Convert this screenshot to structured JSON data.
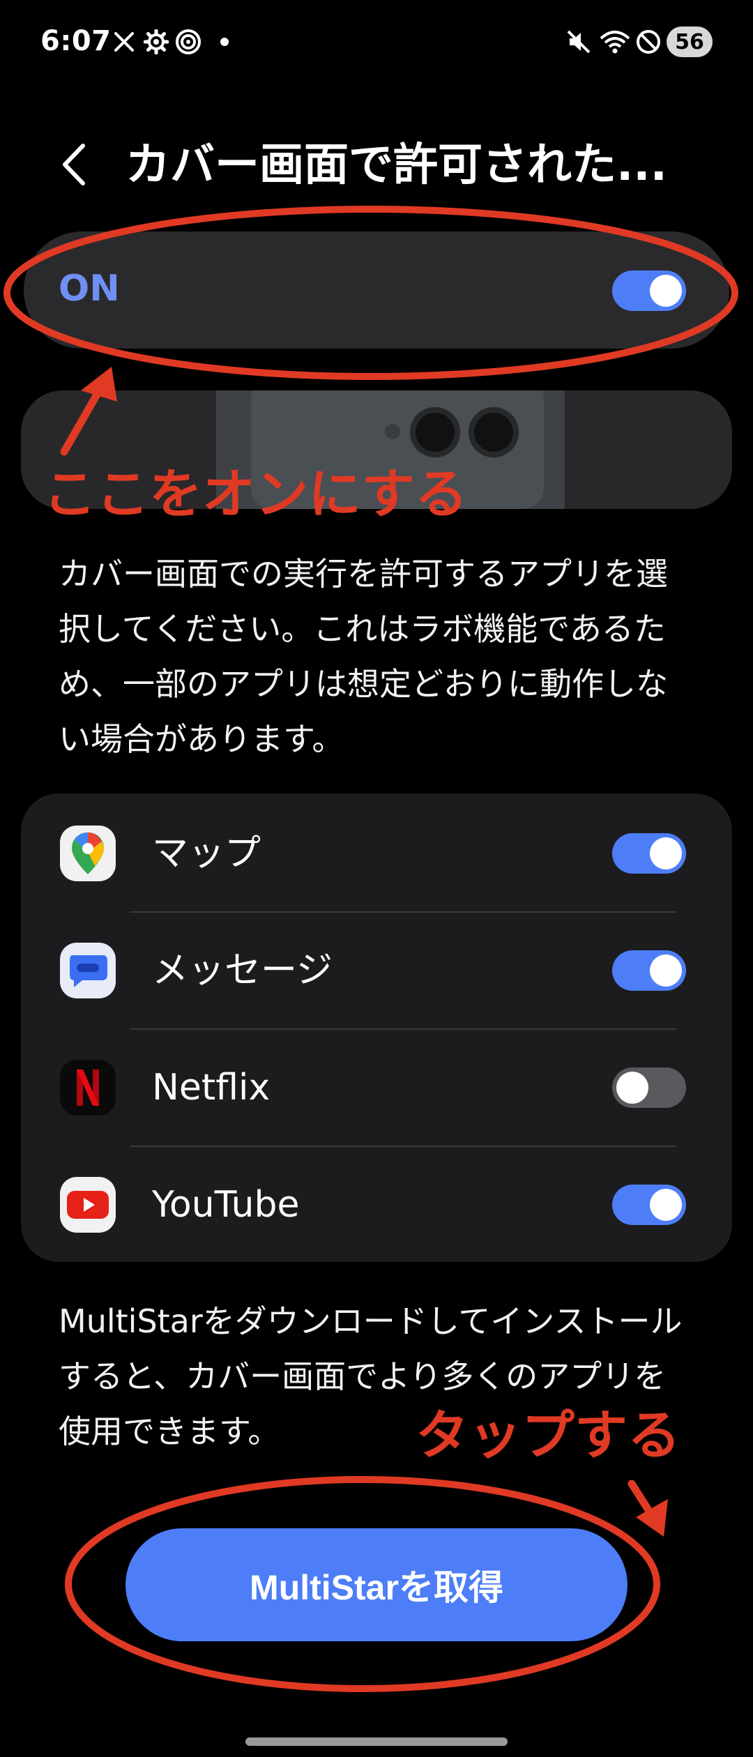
{
  "status_bar": {
    "time": "6:07",
    "battery": "56",
    "icons": [
      "x-icon",
      "gear-icon",
      "target-icon",
      "dot-icon",
      "mute-icon",
      "wifi-icon",
      "dnd-icon"
    ]
  },
  "header": {
    "back_icon": "chevron-left-icon",
    "title": "カバー画面で許可された..."
  },
  "master": {
    "label": "ON",
    "enabled": true
  },
  "description": {
    "lines": [
      "カバー画面での実行を許可するアプリを選",
      "択してください。これはラボ機能であるた",
      "め、一部のアプリは想定どおりに動作しな",
      "い場合があります。"
    ]
  },
  "apps": [
    {
      "name": "マップ",
      "icon": "google-maps-icon",
      "enabled": true
    },
    {
      "name": "メッセージ",
      "icon": "messages-icon",
      "enabled": true
    },
    {
      "name": "Netflix",
      "icon": "netflix-icon",
      "enabled": false
    },
    {
      "name": "YouTube",
      "icon": "youtube-icon",
      "enabled": true
    }
  ],
  "multistar": {
    "lines": [
      "MultiStarをダウンロードしてインストール",
      "すると、カバー画面でより多くのアプリを",
      "使用できます。"
    ],
    "button_label": "MultiStarを取得"
  },
  "annotations": {
    "turn_on": "ここをオンにする",
    "tap": "タップする"
  },
  "colors": {
    "accent": "#4d7ef7",
    "annotation": "#e03a24",
    "background": "#000000",
    "card": "#1c1c1e"
  }
}
